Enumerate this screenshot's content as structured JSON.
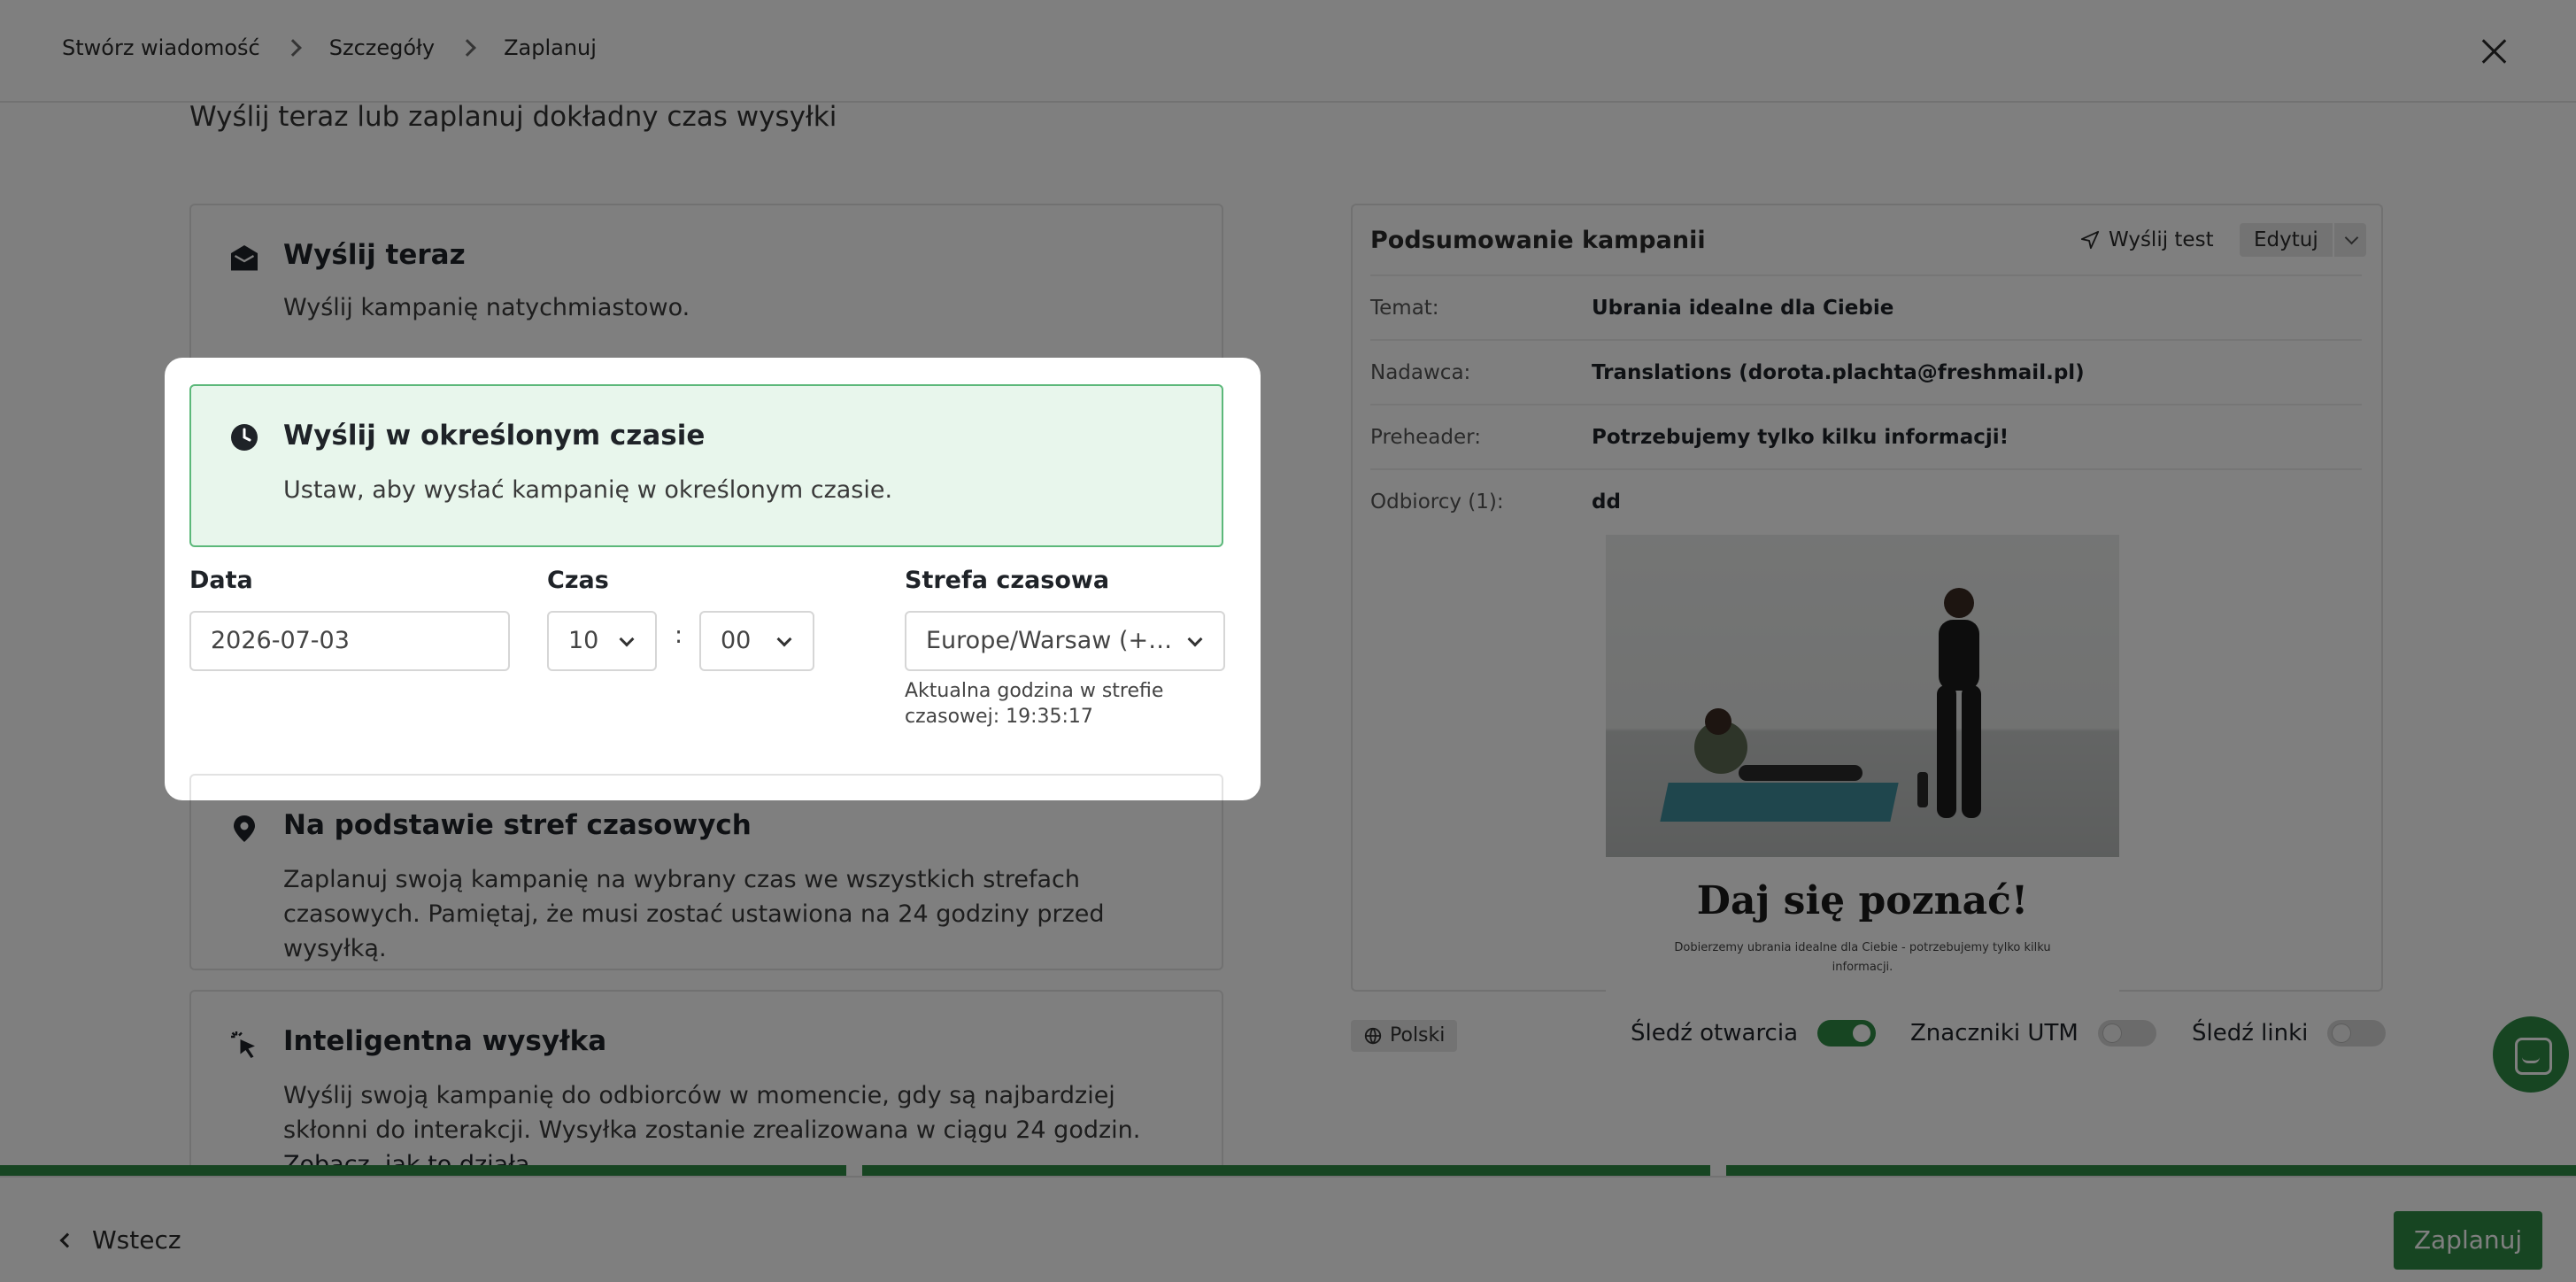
{
  "breadcrumb": [
    "Stwórz wiadomość",
    "Szczegóły",
    "Zaplanuj"
  ],
  "subtitle": "Wyślij teraz lub zaplanuj dokładny czas wysyłki",
  "options": {
    "send_now": {
      "title": "Wyślij teraz",
      "desc": "Wyślij kampanię natychmiastowo.",
      "icon": "envelope-open-icon"
    },
    "scheduled": {
      "title": "Wyślij w określonym czasie",
      "desc": "Ustaw, aby wysłać kampanię w określonym czasie.",
      "icon": "clock-icon"
    },
    "timezones": {
      "title": "Na podstawie stref czasowych",
      "desc": "Zaplanuj swoją kampanię na wybrany czas we wszystkich strefach czasowych. Pamiętaj, że musi zostać ustawiona na 24 godziny przed wysyłką.",
      "icon": "map-pin-icon"
    },
    "smart": {
      "title": "Inteligentna wysyłka",
      "desc": "Wyślij swoją kampanię do odbiorców w momencie, gdy są najbardziej skłonni do interakcji. Wysyłka zostanie zrealizowana w ciągu 24 godzin.",
      "link": "Zobacz, jak to działa",
      "icon": "cursor-click-icon"
    }
  },
  "schedule_form": {
    "date_label": "Data",
    "date_value": "2026-07-03",
    "time_label": "Czas",
    "hour": "10",
    "minute": "00",
    "colon": ":",
    "tz_label": "Strefa czasowa",
    "tz_value": "Europe/Warsaw (+…",
    "tz_note": "Aktualna godzina w strefie czasowej: 19:35:17"
  },
  "summary": {
    "title": "Podsumowanie kampanii",
    "send_test": "Wyślij test",
    "edit": "Edytuj",
    "rows": [
      {
        "key": "Temat:",
        "value": "Ubrania idealne dla Ciebie"
      },
      {
        "key": "Nadawca:",
        "value": "Translations (dorota.plachta@freshmail.pl)"
      },
      {
        "key": "Preheader:",
        "value": "Potrzebujemy tylko kilku informacji!"
      },
      {
        "key": "Odbiorcy (1):",
        "value": "dd"
      }
    ],
    "preview_headline": "Daj się poznać!",
    "preview_text": "Dobierzemy ubrania idealne dla Ciebie - potrzebujemy tylko kilku informacji."
  },
  "tracking": {
    "language": "Polski",
    "opens_label": "Śledź otwarcia",
    "opens_on": true,
    "utm_label": "Znaczniki UTM",
    "utm_on": false,
    "links_label": "Śledź linki",
    "links_on": false
  },
  "footer": {
    "back": "Wstecz",
    "schedule": "Zaplanuj"
  },
  "colors": {
    "brand_green": "#2e8b45",
    "selected_bg": "#e8f6ec",
    "selected_border": "#5cb87a"
  }
}
